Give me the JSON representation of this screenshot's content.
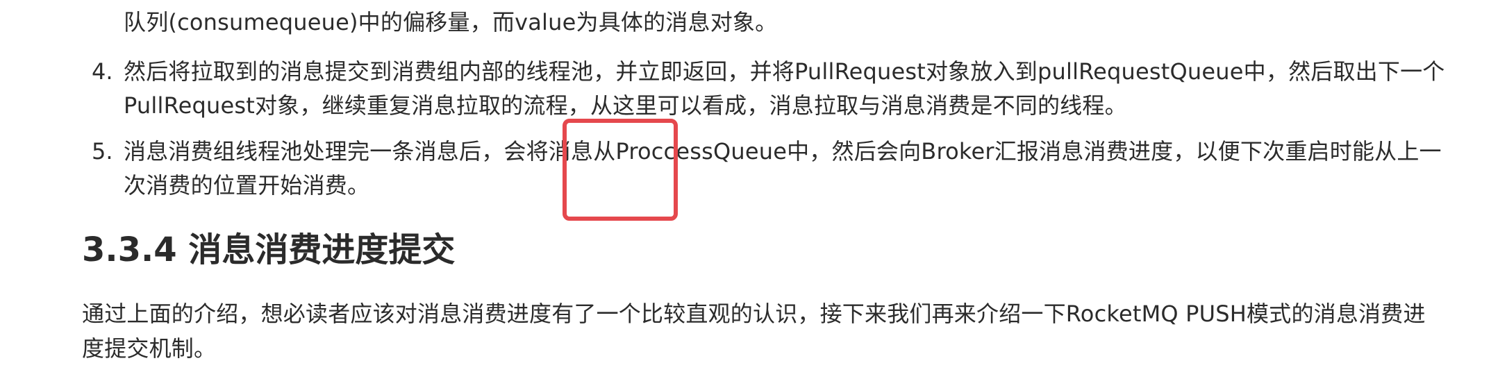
{
  "list": {
    "item3_continuation": "队列(consumequeue)中的偏移量，而value为具体的消息对象。",
    "item4": {
      "number": "4.",
      "line1": "然后将拉取到的消息提交到消费组内部的线程池，并立即返回，并将PullRequest对象放入到pullRequestQueue中，然后取出下一个",
      "line2": "PullRequest对象，继续重复消息拉取的流程，从这里可以看成，消息拉取与消息消费是不同的线程。"
    },
    "item5": {
      "number": "5.",
      "line1": "消息消费组线程池处理完一条消息后，会将消息从ProccessQueue中，然后会向Broker汇报消息消费进度，以便下次重启时能从上一",
      "line2": "次消费的位置开始消费。"
    }
  },
  "section": {
    "heading": "3.3.4 消息消费进度提交",
    "paragraph_line1": "通过上面的介绍，想必读者应该对消息消费进度有了一个比较直观的认识，接下来我们再来介绍一下RocketMQ PUSH模式的消息消费进",
    "paragraph_line2": "度提交机制。"
  },
  "colors": {
    "text": "#2b2b2b",
    "highlight_border": "#e5484d",
    "background": "#ffffff"
  }
}
